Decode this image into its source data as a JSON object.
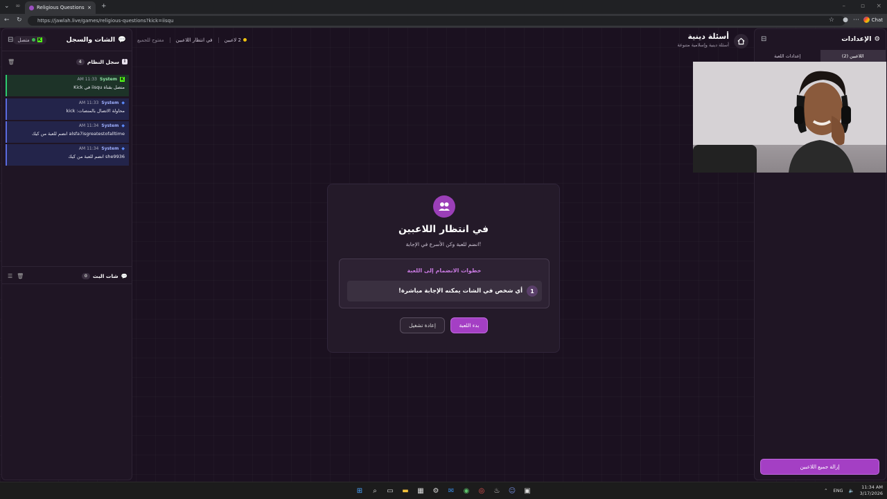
{
  "browser": {
    "tab_title": "Religious Questions - أسئلة دينية",
    "url": "https://jawlah.live/games/religious-questions?kick=iisqu",
    "chat_label": "Chat"
  },
  "left_panel": {
    "title": "الشات والسجل",
    "status": "متصل",
    "system_log": {
      "title": "سجل النظام",
      "count": "4",
      "messages": [
        {
          "time": "11:33 AM",
          "sender": "System",
          "text": "متصل بقناة iisqu في Kick"
        },
        {
          "time": "11:33 AM",
          "sender": "System",
          "text": "محاولة الاتصال بالمنصات: kick"
        },
        {
          "time": "11:34 AM",
          "sender": "System",
          "text": "alsfa7isgreatestofalltime انضم للعبة من كيك"
        },
        {
          "time": "11:34 AM",
          "sender": "System",
          "text": "she9936 انضم للعبة من كيك"
        }
      ]
    },
    "live_chat": {
      "title": "شات البث",
      "count": "0"
    }
  },
  "center": {
    "players_count": "2 لاعبين",
    "state": "في انتظار اللاعبين",
    "access": "مفتوح للجميع",
    "game_title": "أسئلة دينية",
    "game_subtitle": "أسئلة دينية وإسلامية متنوعة",
    "card": {
      "title": "في انتظار اللاعبين",
      "subtitle": "انضم للعبة وكن الأسرع في الإجابة!",
      "steps_title": "خطوات الانضمام إلى اللعبة",
      "step_num": "1",
      "step_text": "أي شخص في الشات يمكنه الإجابة مباشرة!",
      "start_label": "بدء اللعبة",
      "reset_label": "إعادة تشغيل"
    }
  },
  "right_panel": {
    "title": "الإعدادات",
    "tab_players": "اللاعبين (2)",
    "tab_settings": "إعدادات اللعبة",
    "clear_label": "إزالة جميع اللاعبين"
  },
  "taskbar": {
    "lang": "ENG",
    "time": "11:34 AM",
    "date": "3/17/2026"
  },
  "colors": {
    "accent": "#a43fc4",
    "bg": "#1b1120",
    "panel": "#1f1524"
  }
}
